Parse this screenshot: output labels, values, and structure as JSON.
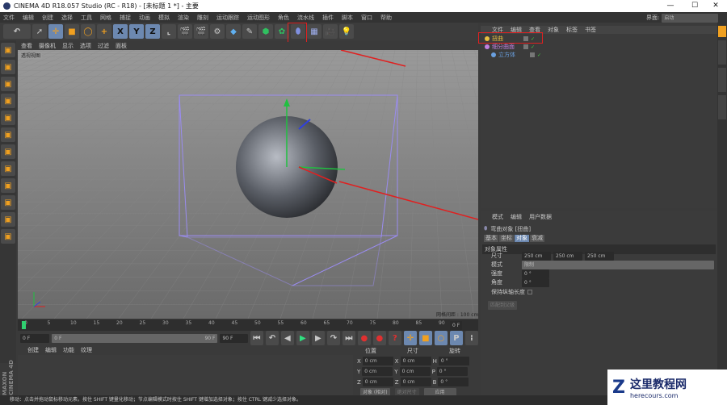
{
  "window": {
    "title": "CINEMA 4D R18.057 Studio (RC - R18) - [未标题 1 *] - 主要",
    "controls": [
      "—",
      "☐",
      "✕"
    ]
  },
  "menu": [
    "文件",
    "编辑",
    "创建",
    "选择",
    "工具",
    "网格",
    "捕捉",
    "动画",
    "模拟",
    "渲染",
    "雕刻",
    "运动跟踪",
    "运动图形",
    "角色",
    "流水线",
    "插件",
    "脚本",
    "窗口",
    "帮助"
  ],
  "toolbar": {
    "icons": [
      "undo-icon",
      "select-icon",
      "move-icon",
      "scale-icon",
      "rotate-icon",
      "add-icon",
      "x-axis-icon",
      "y-axis-icon",
      "z-axis-icon",
      "coord-system-icon",
      "render-view-icon",
      "render-icon",
      "render-settings-icon",
      "cube-icon",
      "pen-icon",
      "subdivision-icon",
      "cloner-icon",
      "bend-deformer-icon",
      "floor-icon",
      "camera-icon",
      "light-icon"
    ],
    "axis_labels": [
      "X",
      "Y",
      "Z"
    ]
  },
  "viewport": {
    "menu": [
      "查看",
      "摄像机",
      "显示",
      "选项",
      "过滤",
      "面板"
    ],
    "label": "透视视图",
    "grid_spacing": "网格间距 : 100 cm"
  },
  "timeline": {
    "ticks": [
      "0",
      "5",
      "10",
      "15",
      "20",
      "25",
      "30",
      "35",
      "40",
      "45",
      "50",
      "55",
      "60",
      "65",
      "70",
      "75",
      "80",
      "85",
      "90"
    ],
    "current": "0 F",
    "start": "0 F",
    "range_start": "0 F",
    "range_end": "90 F",
    "end": "90 F"
  },
  "material": {
    "menu": [
      "创建",
      "编辑",
      "功能",
      "纹理"
    ]
  },
  "coords": {
    "headers": [
      "位置",
      "尺寸",
      "旋转"
    ],
    "rows": [
      {
        "a": "X",
        "pos": "0 cm",
        "b": "X",
        "size": "0 cm",
        "c": "H",
        "rot": "0 °"
      },
      {
        "a": "Y",
        "pos": "0 cm",
        "b": "Y",
        "size": "0 cm",
        "c": "P",
        "rot": "0 °"
      },
      {
        "a": "Z",
        "pos": "0 cm",
        "b": "Z",
        "size": "0 cm",
        "c": "B",
        "rot": "0 °"
      }
    ],
    "mode": "对象 (相对)",
    "size_mode": "绝对尺寸",
    "apply": "应用"
  },
  "status": "移动：点击并拖动鼠标移动元素。按住 SHIFT 键量化移动；节点编辑模式时按住 SHIFT 键增加选择对象；按住 CTRL 键减少选择对象。",
  "layout_label": "界面:",
  "layout_value": "启动",
  "objects": {
    "menu": [
      "文件",
      "编辑",
      "查看",
      "对象",
      "标签",
      "书签"
    ],
    "items": [
      {
        "name": "扭曲",
        "color": "#e8c040"
      },
      {
        "name": "细分曲面",
        "color": "#c080e0"
      },
      {
        "name": "立方体",
        "color": "#6aa0e0"
      }
    ]
  },
  "attributes": {
    "menu": [
      "模式",
      "编辑",
      "用户数据"
    ],
    "object_title": "弯曲对象 [扭曲]",
    "tabs": [
      "基本",
      "坐标",
      "对象",
      "衰减"
    ],
    "section": "对象属性",
    "size_label": "尺寸",
    "size": [
      "250 cm",
      "250 cm",
      "250 cm"
    ],
    "mode_label": "模式",
    "mode": "限制",
    "strength_label": "强度",
    "strength": "0 °",
    "angle_label": "角度",
    "angle": "0 °",
    "keep_label": "保持纵轴长度",
    "fit_button": "匹配到父级"
  },
  "brand": "MAXON CINEMA 4D",
  "watermark": {
    "name": "这里教程网",
    "url": "herecours.com"
  },
  "colors": {
    "accent": "#6c88b0",
    "annotation": "#e02020",
    "selection": "#8080ff"
  }
}
